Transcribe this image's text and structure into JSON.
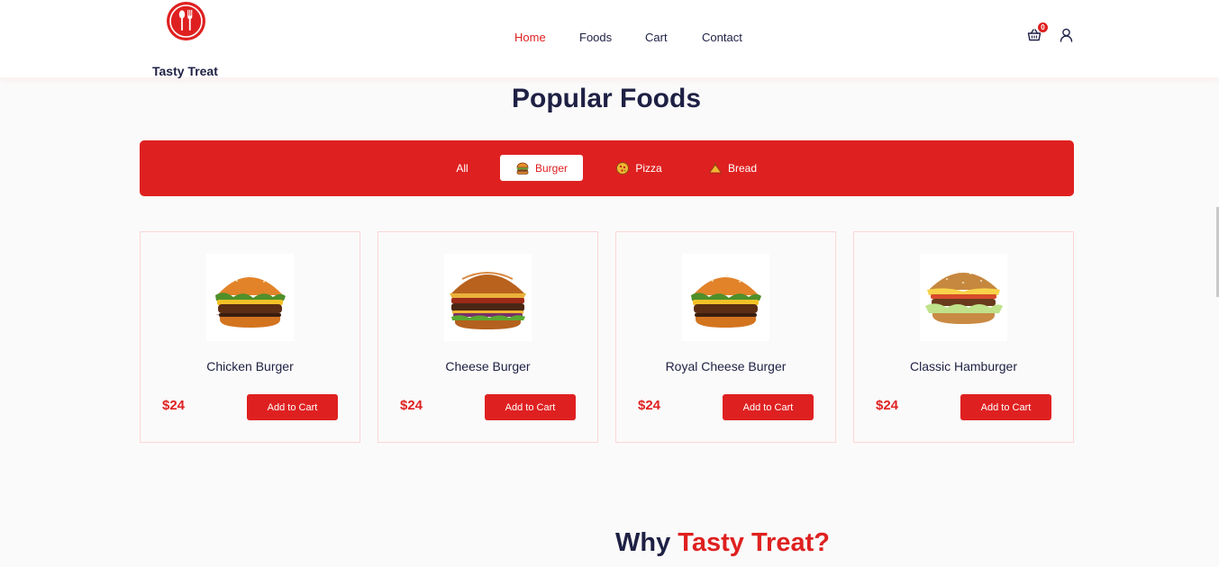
{
  "brand": {
    "name": "Tasty Treat",
    "logo_icon": "spoon-fork-icon",
    "accent_color": "#df2020",
    "text_color": "#1e2044"
  },
  "nav": {
    "items": [
      {
        "label": "Home",
        "active": true
      },
      {
        "label": "Foods",
        "active": false
      },
      {
        "label": "Cart",
        "active": false
      },
      {
        "label": "Contact",
        "active": false
      }
    ]
  },
  "header_actions": {
    "cart_icon": "shopping-basket-icon",
    "cart_count": "0",
    "user_icon": "user-icon"
  },
  "popular": {
    "title": "Popular Foods",
    "filters": [
      {
        "label": "All",
        "icon": "",
        "active": false
      },
      {
        "label": "Burger",
        "icon": "burger-icon",
        "active": true
      },
      {
        "label": "Pizza",
        "icon": "pizza-icon",
        "active": false
      },
      {
        "label": "Bread",
        "icon": "bread-icon",
        "active": false
      }
    ],
    "products": [
      {
        "name": "Chicken Burger",
        "price": "$24",
        "button": "Add to Cart",
        "image": "burger-image"
      },
      {
        "name": "Cheese Burger",
        "price": "$24",
        "button": "Add to Cart",
        "image": "burger-image"
      },
      {
        "name": "Royal Cheese Burger",
        "price": "$24",
        "button": "Add to Cart",
        "image": "burger-image"
      },
      {
        "name": "Classic Hamburger",
        "price": "$24",
        "button": "Add to Cart",
        "image": "burger-image"
      }
    ]
  },
  "why": {
    "title_prefix": "Why",
    "title_accent": "Tasty Treat?"
  }
}
